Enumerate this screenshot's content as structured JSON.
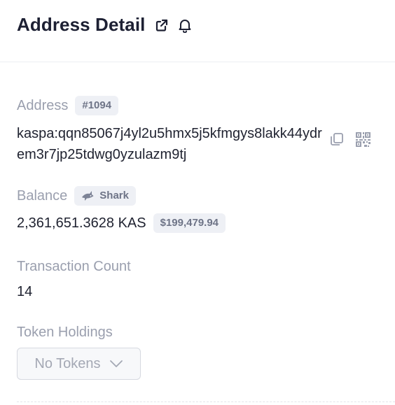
{
  "header": {
    "title": "Address Detail",
    "icons": [
      "external-link-icon",
      "bell-icon"
    ]
  },
  "address": {
    "label": "Address",
    "rank_badge": "#1094",
    "value": "kaspa:qqn85067j4yl2u5hmx5j5kfmgys8lakk44ydrem3r7jp25tdwg0yzulazm9tj",
    "actions": [
      "copy-icon",
      "qr-code-icon"
    ]
  },
  "balance": {
    "label": "Balance",
    "tier_icon": "shark-icon",
    "tier_badge": "Shark",
    "amount": "2,361,651.3628 KAS",
    "usd_value": "$199,479.94"
  },
  "transactions": {
    "label": "Transaction Count",
    "count": "14"
  },
  "tokens": {
    "label": "Token Holdings",
    "selected": "No Tokens"
  },
  "colors": {
    "label_gray": "#9a9fae",
    "badge_bg": "#eef0f5",
    "badge_text": "#6e7487",
    "title": "#1d2033"
  }
}
